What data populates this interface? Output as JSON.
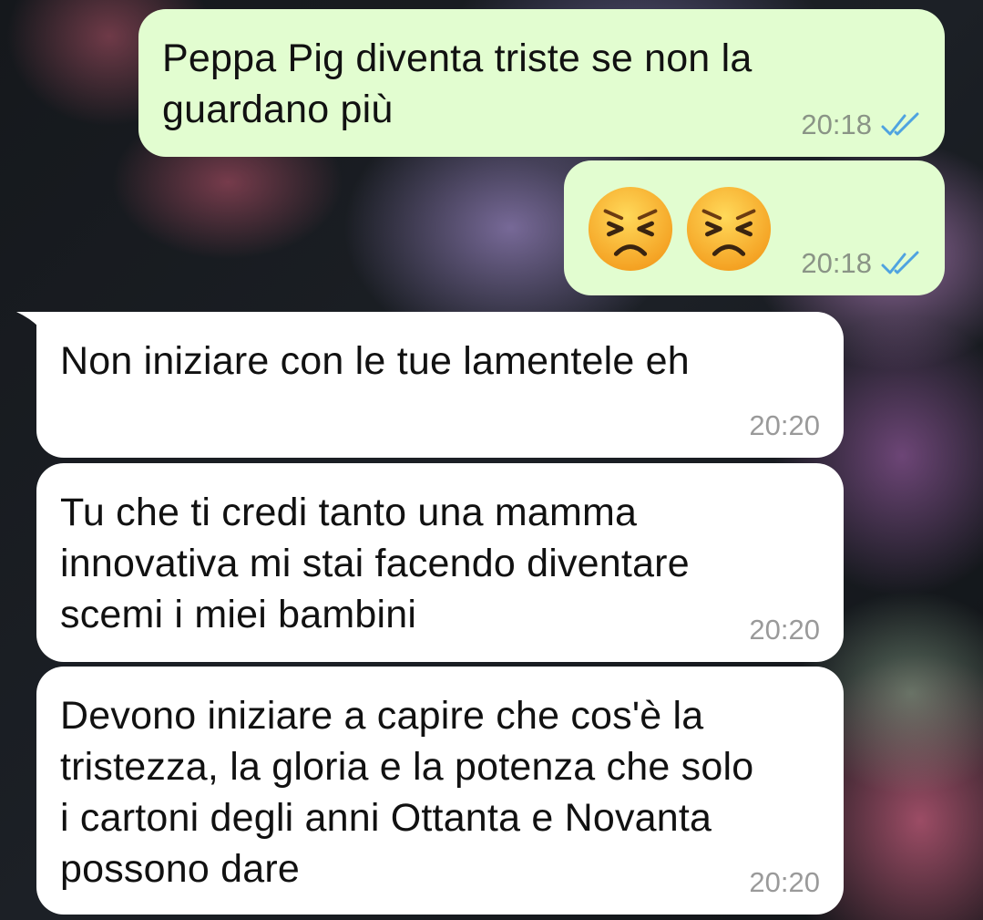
{
  "colors": {
    "outgoing_bubble": "#e2fdd0",
    "incoming_bubble": "#ffffff",
    "read_ticks": "#4fa3e0",
    "timestamp_out": "#8a9486",
    "timestamp_in": "#9a9a9a"
  },
  "messages": [
    {
      "direction": "outgoing",
      "text": "Peppa Pig diventa triste se non la\nguardano più",
      "time": "20:18",
      "status_icon": "double-check-read-icon"
    },
    {
      "direction": "outgoing",
      "emoji": [
        "persevering-face-emoji",
        "persevering-face-emoji"
      ],
      "time": "20:18",
      "status_icon": "double-check-read-icon"
    },
    {
      "direction": "incoming",
      "text": "Non iniziare con le tue lamentele eh",
      "time": "20:20"
    },
    {
      "direction": "incoming",
      "text": "Tu che ti credi tanto una mamma\ninnovativa mi stai facendo diventare\nscemi i miei bambini",
      "time": "20:20"
    },
    {
      "direction": "incoming",
      "text": "Devono iniziare a capire che cos'è la\ntristezza, la gloria e la potenza che solo\ni cartoni degli anni Ottanta e Novanta\npossono dare",
      "time": "20:20"
    }
  ]
}
